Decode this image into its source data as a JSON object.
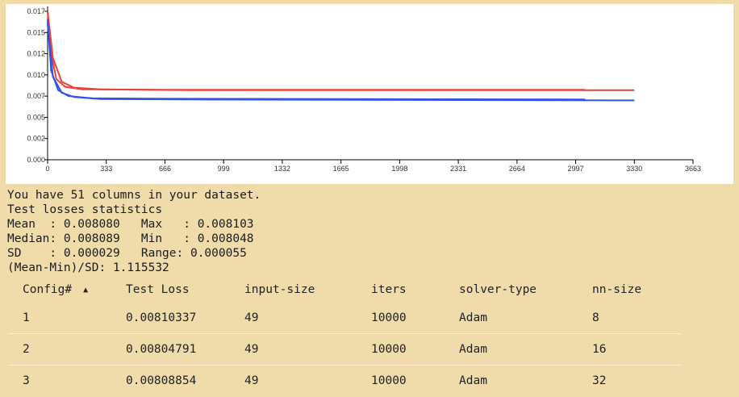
{
  "chart_data": {
    "type": "line",
    "title": "",
    "xlabel": "",
    "ylabel": "",
    "xlim": [
      0,
      3663
    ],
    "ylim": [
      0,
      0.0175
    ],
    "x_ticks": [
      "0",
      "333",
      "666",
      "999",
      "1332",
      "1665",
      "1998",
      "2331",
      "2664",
      "2997",
      "3330",
      "3663"
    ],
    "y_ticks": [
      {
        "v": 0.0,
        "label": "0.000"
      },
      {
        "v": 0.0025,
        "label": "0.002"
      },
      {
        "v": 0.005,
        "label": "0.005"
      },
      {
        "v": 0.0075,
        "label": "0.007"
      },
      {
        "v": 0.01,
        "label": "0.010"
      },
      {
        "v": 0.0125,
        "label": "0.012"
      },
      {
        "v": 0.015,
        "label": "0.015"
      },
      {
        "v": 0.0175,
        "label": "0.017"
      }
    ],
    "series": [
      {
        "color": "#e8423a",
        "points": [
          [
            0,
            0.0175
          ],
          [
            20,
            0.0125
          ],
          [
            50,
            0.0095
          ],
          [
            100,
            0.0086
          ],
          [
            200,
            0.0083
          ],
          [
            600,
            0.00825
          ],
          [
            3050,
            0.00825
          ]
        ]
      },
      {
        "color": "#e8423a",
        "points": [
          [
            0,
            0.0175
          ],
          [
            30,
            0.012
          ],
          [
            80,
            0.0092
          ],
          [
            150,
            0.0085
          ],
          [
            300,
            0.0083
          ],
          [
            800,
            0.0082
          ],
          [
            3330,
            0.0082
          ]
        ]
      },
      {
        "color": "#3352e8",
        "points": [
          [
            0,
            0.0165
          ],
          [
            20,
            0.0105
          ],
          [
            60,
            0.0082
          ],
          [
            120,
            0.0075
          ],
          [
            250,
            0.00725
          ],
          [
            600,
            0.0072
          ],
          [
            3050,
            0.0071
          ]
        ]
      },
      {
        "color": "#3352e8",
        "points": [
          [
            0,
            0.016
          ],
          [
            30,
            0.0098
          ],
          [
            80,
            0.0079
          ],
          [
            150,
            0.0074
          ],
          [
            300,
            0.00715
          ],
          [
            800,
            0.0071
          ],
          [
            3330,
            0.007
          ]
        ]
      }
    ]
  },
  "stats": {
    "line1": "You have 51 columns in your dataset.",
    "line2": "Test losses statistics",
    "line3": "Mean  : 0.008080   Max   : 0.008103",
    "line4": "Median: 0.008089   Min   : 0.008048",
    "line5": "SD    : 0.000029   Range: 0.000055",
    "line6": "(Mean-Min)/SD: 1.115532"
  },
  "table": {
    "headers": [
      "Config#",
      "Test Loss",
      "input-size",
      "iters",
      "solver-type",
      "nn-size"
    ],
    "sort_indicator": "▲",
    "rows": [
      [
        "1",
        "0.00810337",
        "49",
        "10000",
        "Adam",
        "8"
      ],
      [
        "2",
        "0.00804791",
        "49",
        "10000",
        "Adam",
        "16"
      ],
      [
        "3",
        "0.00808854",
        "49",
        "10000",
        "Adam",
        "32"
      ]
    ]
  }
}
